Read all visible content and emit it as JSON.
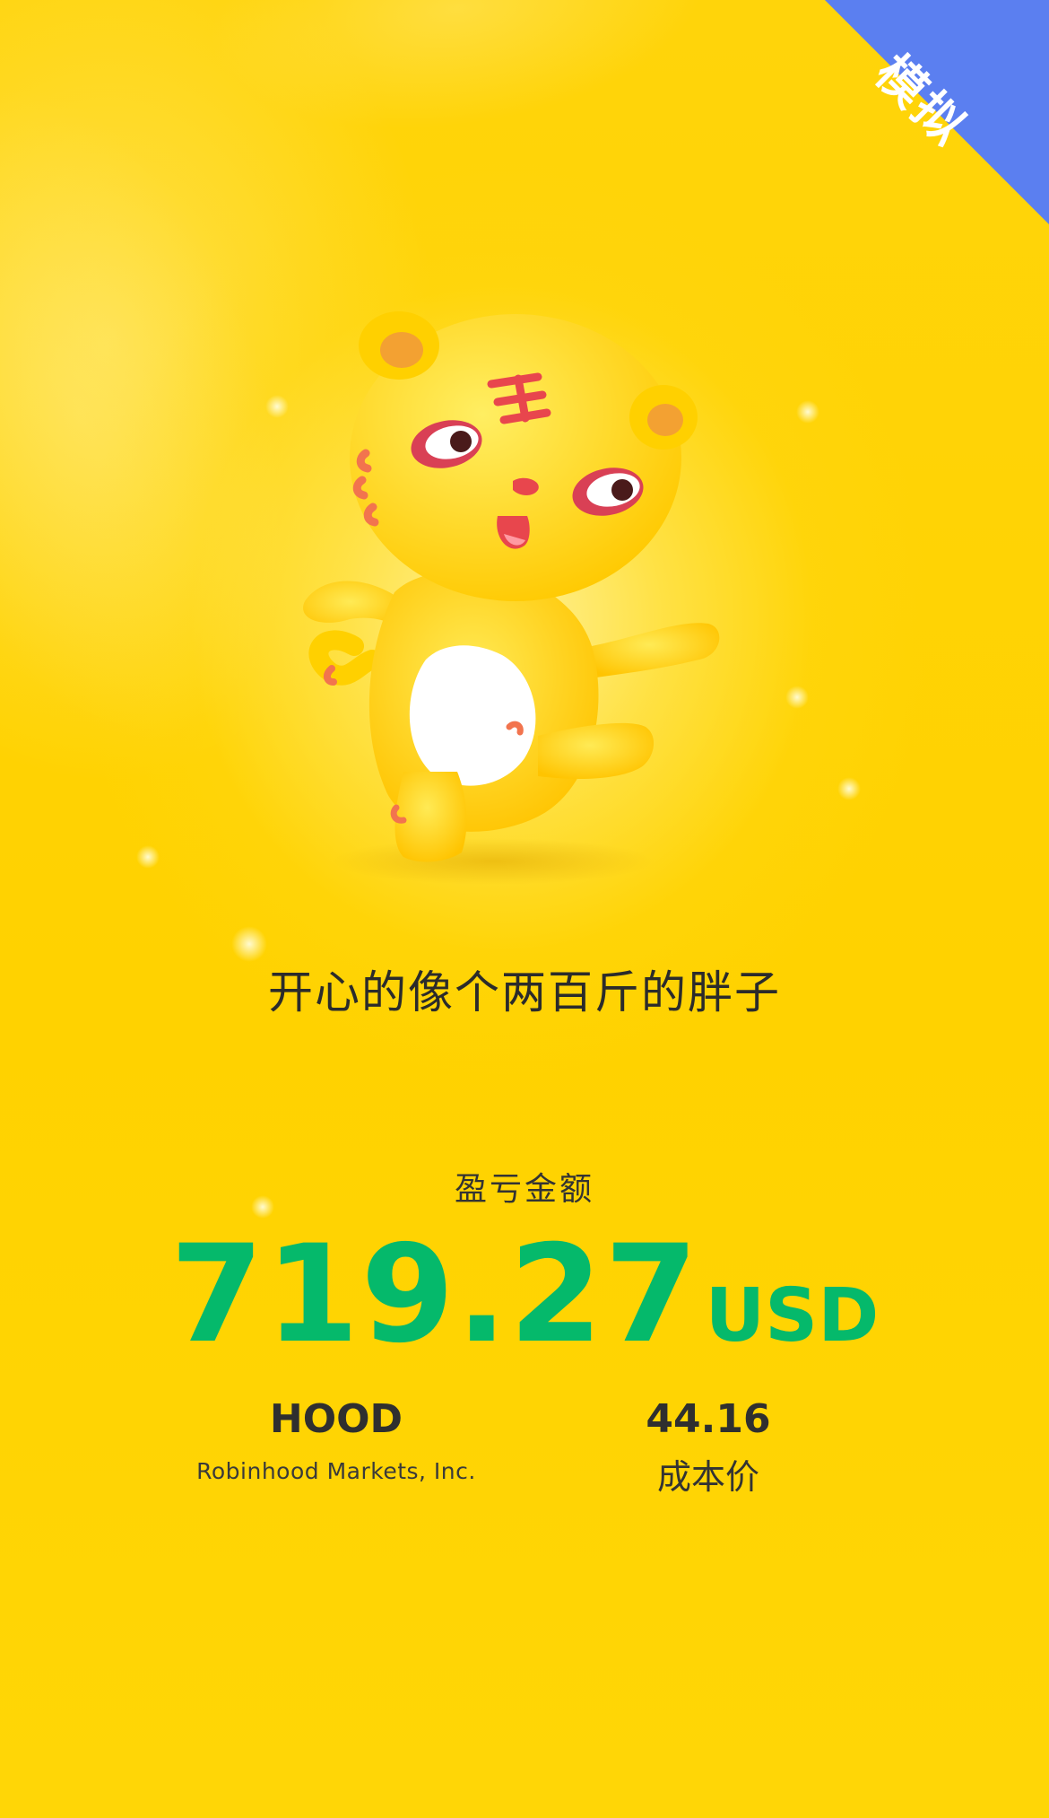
{
  "badge": {
    "label": "模拟",
    "color": "#5b7ff0"
  },
  "hero": {
    "mascot_icon": "tiger-mascot",
    "slogan": "开心的像个两百斤的胖子"
  },
  "pnl": {
    "label": "盈亏金额",
    "amount": "719.27",
    "currency": "USD",
    "color": "#05b96b"
  },
  "stock": {
    "symbol": "HOOD",
    "name": "Robinhood Markets, Inc."
  },
  "cost": {
    "value": "44.16",
    "label": "成本价"
  },
  "colors": {
    "background": "#ffd503",
    "text": "#2f2f2f"
  }
}
